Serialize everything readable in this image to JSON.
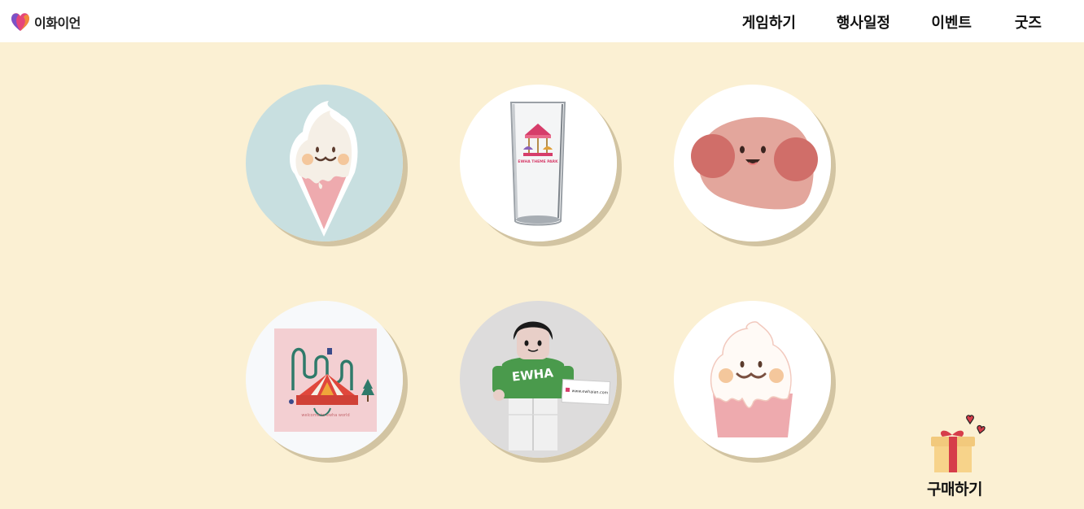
{
  "brand": {
    "name": "이화이언"
  },
  "nav": {
    "items": [
      {
        "label": "게임하기"
      },
      {
        "label": "행사일정"
      },
      {
        "label": "이벤트"
      },
      {
        "label": "굿즈"
      }
    ]
  },
  "goods": {
    "items": [
      {
        "image": "ice-cream-cone-character"
      },
      {
        "image": "carousel-print-glass",
        "glass_text": "EWHA THEME PARK"
      },
      {
        "image": "pink-blob-face-character"
      },
      {
        "image": "theme-park-illustration-card",
        "card_text": "welcome to ewha world"
      },
      {
        "image": "ewha-hoodie-figure",
        "shirt_text": "EWHA",
        "card_text": "www.ewhaian.com"
      },
      {
        "image": "soft-serve-cup-character"
      }
    ]
  },
  "buy": {
    "label": "구매하기",
    "icon": "gift-icon"
  },
  "colors": {
    "background": "#fbf0d3",
    "header": "#ffffff",
    "shadow": "#d2c4a2",
    "accent": "#d63d4a"
  }
}
